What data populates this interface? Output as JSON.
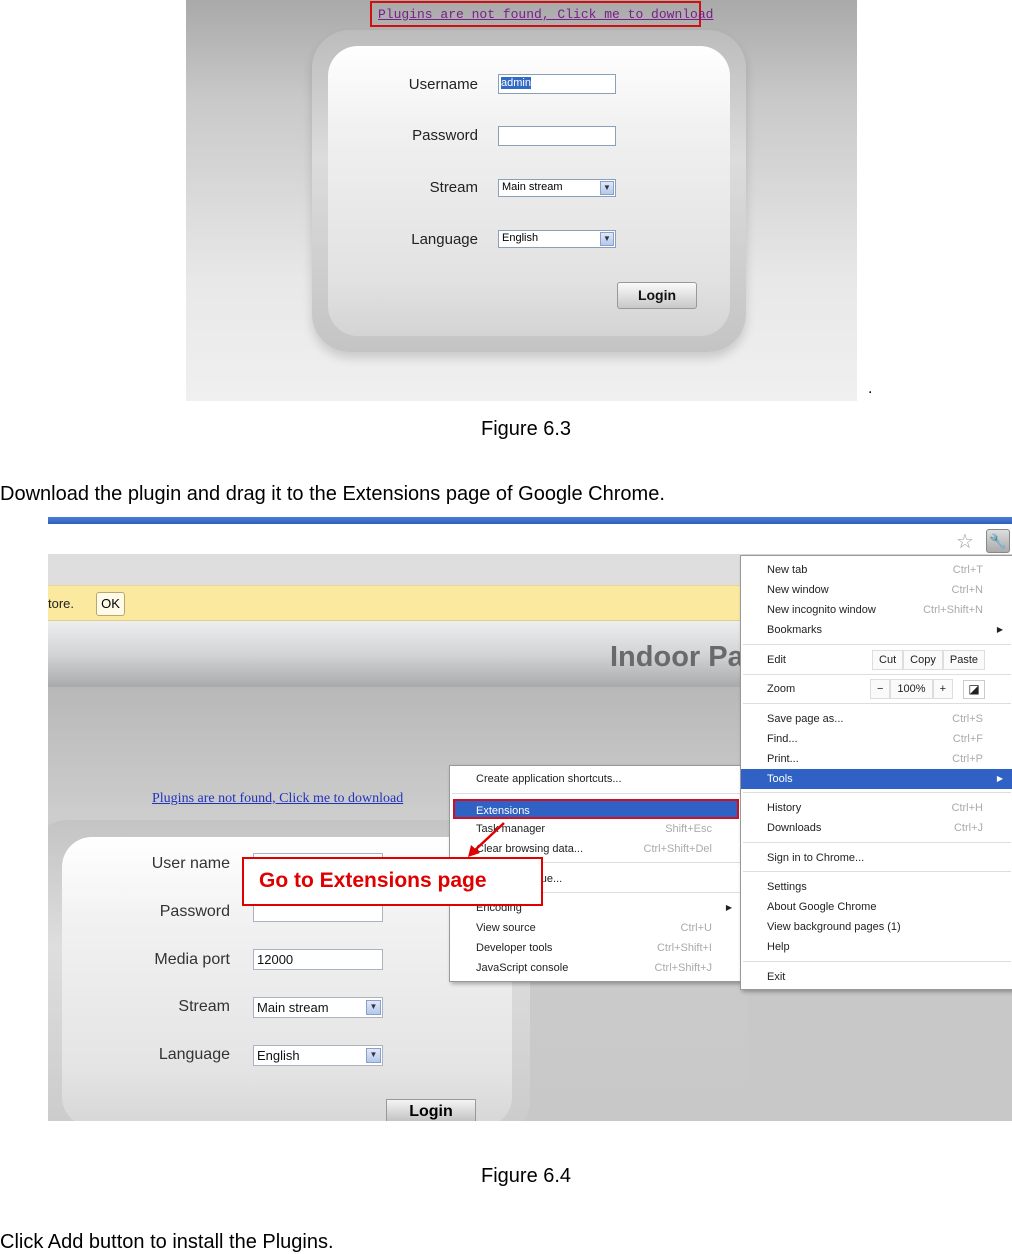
{
  "figure63": {
    "plugin_link": "Plugins are not found, Click me to download",
    "fields": [
      {
        "label": "Username",
        "value": "admin"
      },
      {
        "label": "Password",
        "value": ""
      },
      {
        "label": "Stream",
        "value": "Main stream"
      },
      {
        "label": "Language",
        "value": "English"
      }
    ],
    "login": "Login",
    "trailing_dot": ".",
    "caption": "Figure 6.3"
  },
  "instruction1": "Download the plugin and drag it to the Extensions page of Google Chrome.",
  "figure64": {
    "infobar_text": "tore.",
    "infobar_ok": "OK",
    "page_title": "Indoor Pa",
    "plugin_link": "Plugins are not found, Click me to download",
    "fields": [
      {
        "label": "User name",
        "value": ""
      },
      {
        "label": "Password",
        "value": ""
      },
      {
        "label": "Media port",
        "value": "12000"
      },
      {
        "label": "Stream",
        "value": "Main stream"
      },
      {
        "label": "Language",
        "value": "English"
      }
    ],
    "login": "Login",
    "callout": "Go to Extensions page",
    "callout_color": "#e00000",
    "menu": {
      "new_tab": {
        "label": "New tab",
        "shortcut": "Ctrl+T"
      },
      "new_window": {
        "label": "New window",
        "shortcut": "Ctrl+N"
      },
      "incognito": {
        "label": "New incognito window",
        "shortcut": "Ctrl+Shift+N"
      },
      "bookmarks": {
        "label": "Bookmarks"
      },
      "edit": {
        "label": "Edit",
        "cut": "Cut",
        "copy": "Copy",
        "paste": "Paste"
      },
      "zoom": {
        "label": "Zoom",
        "minus": "−",
        "level": "100%",
        "plus": "+"
      },
      "save": {
        "label": "Save page as...",
        "shortcut": "Ctrl+S"
      },
      "find": {
        "label": "Find...",
        "shortcut": "Ctrl+F"
      },
      "print": {
        "label": "Print...",
        "shortcut": "Ctrl+P"
      },
      "tools": {
        "label": "Tools"
      },
      "history": {
        "label": "History",
        "shortcut": "Ctrl+H"
      },
      "downloads": {
        "label": "Downloads",
        "shortcut": "Ctrl+J"
      },
      "signin": {
        "label": "Sign in to Chrome..."
      },
      "settings": {
        "label": "Settings"
      },
      "about": {
        "label": "About Google Chrome"
      },
      "background": {
        "label": "View background pages (1)"
      },
      "help": {
        "label": "Help"
      },
      "exit": {
        "label": "Exit"
      }
    },
    "submenu": {
      "shortcuts": {
        "label": "Create application shortcuts..."
      },
      "extensions": {
        "label": "Extensions"
      },
      "task": {
        "label": "Task manager",
        "shortcut": "Shift+Esc"
      },
      "clear": {
        "label": "Clear browsing data...",
        "shortcut": "Ctrl+Shift+Del"
      },
      "report": {
        "label": "Report an issue..."
      },
      "encoding": {
        "label": "Encoding"
      },
      "source": {
        "label": "View source",
        "shortcut": "Ctrl+U"
      },
      "devtools": {
        "label": "Developer tools",
        "shortcut": "Ctrl+Shift+I"
      },
      "console": {
        "label": "JavaScript console",
        "shortcut": "Ctrl+Shift+J"
      }
    },
    "caption": "Figure 6.4"
  },
  "instruction2": "Click Add button to install the Plugins."
}
